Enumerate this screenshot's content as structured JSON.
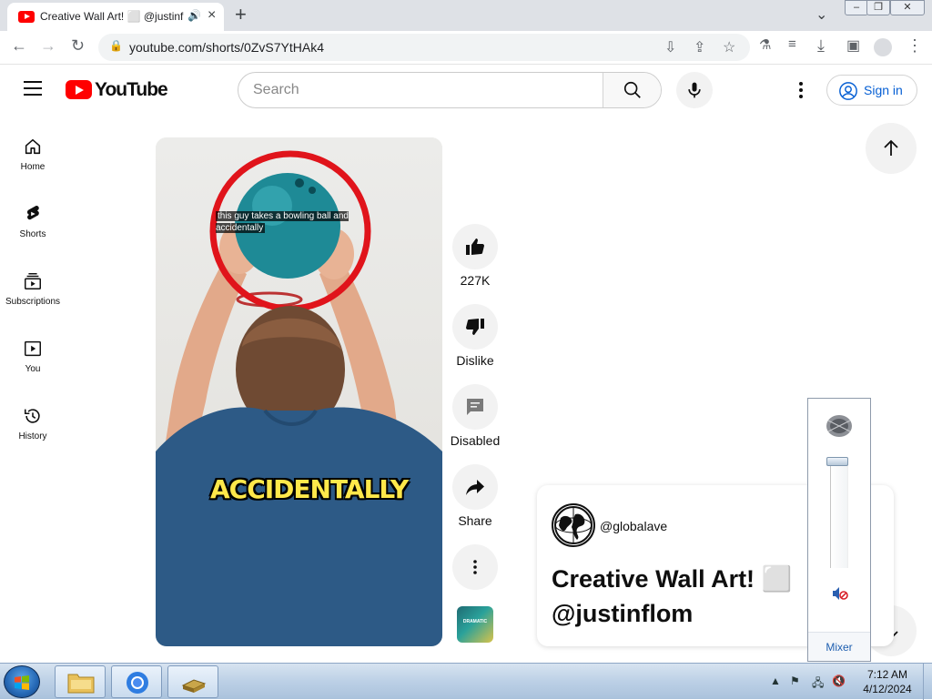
{
  "browser": {
    "tab": {
      "title": "Creative Wall Art! ⬜ @justinflom",
      "audio_icon": "speaker-icon",
      "close_icon": "close-icon"
    },
    "new_tab_label": "+",
    "url": "youtube.com/shorts/0ZvS7YtHAk4",
    "window_controls": [
      "minimize",
      "restore",
      "close"
    ]
  },
  "youtube": {
    "logo_text": "YouTube",
    "search": {
      "placeholder": "Search"
    },
    "signin_label": "Sign in",
    "nav": [
      {
        "label": "Home",
        "icon": "home-icon"
      },
      {
        "label": "Shorts",
        "icon": "shorts-icon"
      },
      {
        "label": "Subscriptions",
        "icon": "subscriptions-icon"
      },
      {
        "label": "You",
        "icon": "you-icon"
      },
      {
        "label": "History",
        "icon": "history-icon"
      }
    ]
  },
  "video": {
    "caption_small": "this guy takes a bowling ball and accidentally",
    "caption_big": "ACCIDENTALLY"
  },
  "actions": {
    "like_count": "227K",
    "dislike_label": "Dislike",
    "comments_label": "Disabled",
    "share_label": "Share"
  },
  "channel_thumb_text": "DRAMATIC",
  "info": {
    "handle": "@globalave",
    "title": "Creative Wall Art! ⬜ @justinflom"
  },
  "mixer": {
    "label": "Mixer"
  },
  "taskbar": {
    "time": "7:12 AM",
    "date": "4/12/2024"
  },
  "colors": {
    "youtube_red": "#ff0000",
    "link_blue": "#065fd4"
  }
}
